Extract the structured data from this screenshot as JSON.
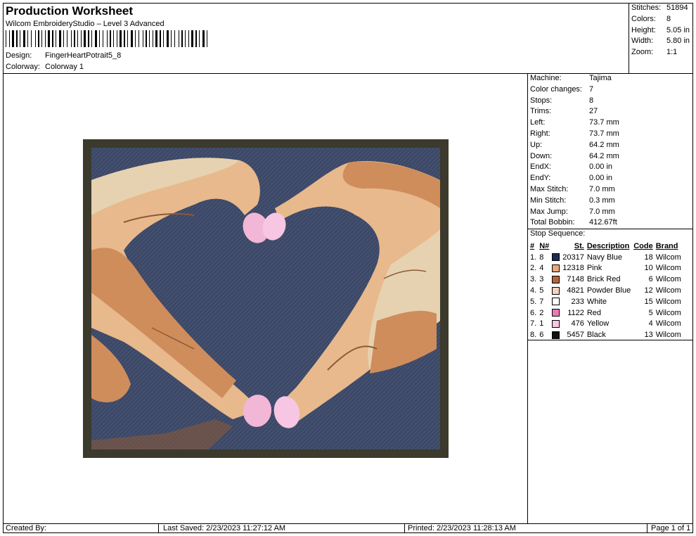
{
  "header": {
    "title": "Production Worksheet",
    "software": "Wilcom EmbroideryStudio – Level 3 Advanced",
    "design_label": "Design:",
    "design_value": "FingerHeartPotrait5_8",
    "colorway_label": "Colorway:",
    "colorway_value": "Colorway 1"
  },
  "summary": [
    {
      "label": "Stitches:",
      "value": "51894"
    },
    {
      "label": "Colors:",
      "value": "8"
    },
    {
      "label": "Height:",
      "value": "5.05 in"
    },
    {
      "label": "Width:",
      "value": "5.80 in"
    },
    {
      "label": "Zoom:",
      "value": "1:1"
    }
  ],
  "machine_info": [
    {
      "label": "Machine:",
      "value": "Tajima"
    },
    {
      "label": "Color changes:",
      "value": "7"
    },
    {
      "label": "Stops:",
      "value": "8"
    },
    {
      "label": "Trims:",
      "value": "27"
    },
    {
      "label": "Left:",
      "value": "73.7 mm"
    },
    {
      "label": "Right:",
      "value": "73.7 mm"
    },
    {
      "label": "Up:",
      "value": "64.2 mm"
    },
    {
      "label": "Down:",
      "value": "64.2 mm"
    },
    {
      "label": "EndX:",
      "value": "0.00 in"
    },
    {
      "label": "EndY:",
      "value": "0.00 in"
    },
    {
      "label": "Max Stitch:",
      "value": "7.0 mm"
    },
    {
      "label": "Min Stitch:",
      "value": "0.3 mm"
    },
    {
      "label": "Max Jump:",
      "value": "7.0 mm"
    },
    {
      "label": "Total Bobbin:",
      "value": "412.67ft"
    }
  ],
  "stop_sequence": {
    "title": "Stop Sequence:",
    "headers": {
      "idx": "#",
      "n": "N#",
      "st": "St.",
      "desc": "Description",
      "code": "Code",
      "brand": "Brand"
    },
    "rows": [
      {
        "idx": "1.",
        "n": "8",
        "color": "#1f2a4e",
        "st": "20317",
        "desc": "Navy Blue",
        "code": "18",
        "brand": "Wilcom"
      },
      {
        "idx": "2.",
        "n": "4",
        "color": "#e8a77c",
        "st": "12318",
        "desc": "Pink",
        "code": "10",
        "brand": "Wilcom"
      },
      {
        "idx": "3.",
        "n": "3",
        "color": "#b5643c",
        "st": "7148",
        "desc": "Brick Red",
        "code": "6",
        "brand": "Wilcom"
      },
      {
        "idx": "4.",
        "n": "5",
        "color": "#f6d2c0",
        "st": "4821",
        "desc": "Powder Blue",
        "code": "12",
        "brand": "Wilcom"
      },
      {
        "idx": "5.",
        "n": "7",
        "color": "#ffffff",
        "st": "233",
        "desc": "White",
        "code": "15",
        "brand": "Wilcom"
      },
      {
        "idx": "6.",
        "n": "2",
        "color": "#e97ab8",
        "st": "1122",
        "desc": "Red",
        "code": "5",
        "brand": "Wilcom"
      },
      {
        "idx": "7.",
        "n": "1",
        "color": "#f6c6e2",
        "st": "476",
        "desc": "Yellow",
        "code": "4",
        "brand": "Wilcom"
      },
      {
        "idx": "8.",
        "n": "6",
        "color": "#111111",
        "st": "5457",
        "desc": "Black",
        "code": "13",
        "brand": "Wilcom"
      }
    ]
  },
  "footer": {
    "created_by": "Created By:",
    "last_saved": "Last Saved: 2/23/2023 11:27:12 AM",
    "printed": "Printed: 2/23/2023 11:28:13 AM",
    "page": "Page 1 of 1"
  },
  "colors": {
    "background_navy": "#3c4866",
    "skin_light": "#e8b98c",
    "skin_mid": "#cf8d5c",
    "skin_dark": "#8e5a35",
    "nail_pink": "#f2b6d6",
    "frame_olive": "#3b3a2c"
  }
}
